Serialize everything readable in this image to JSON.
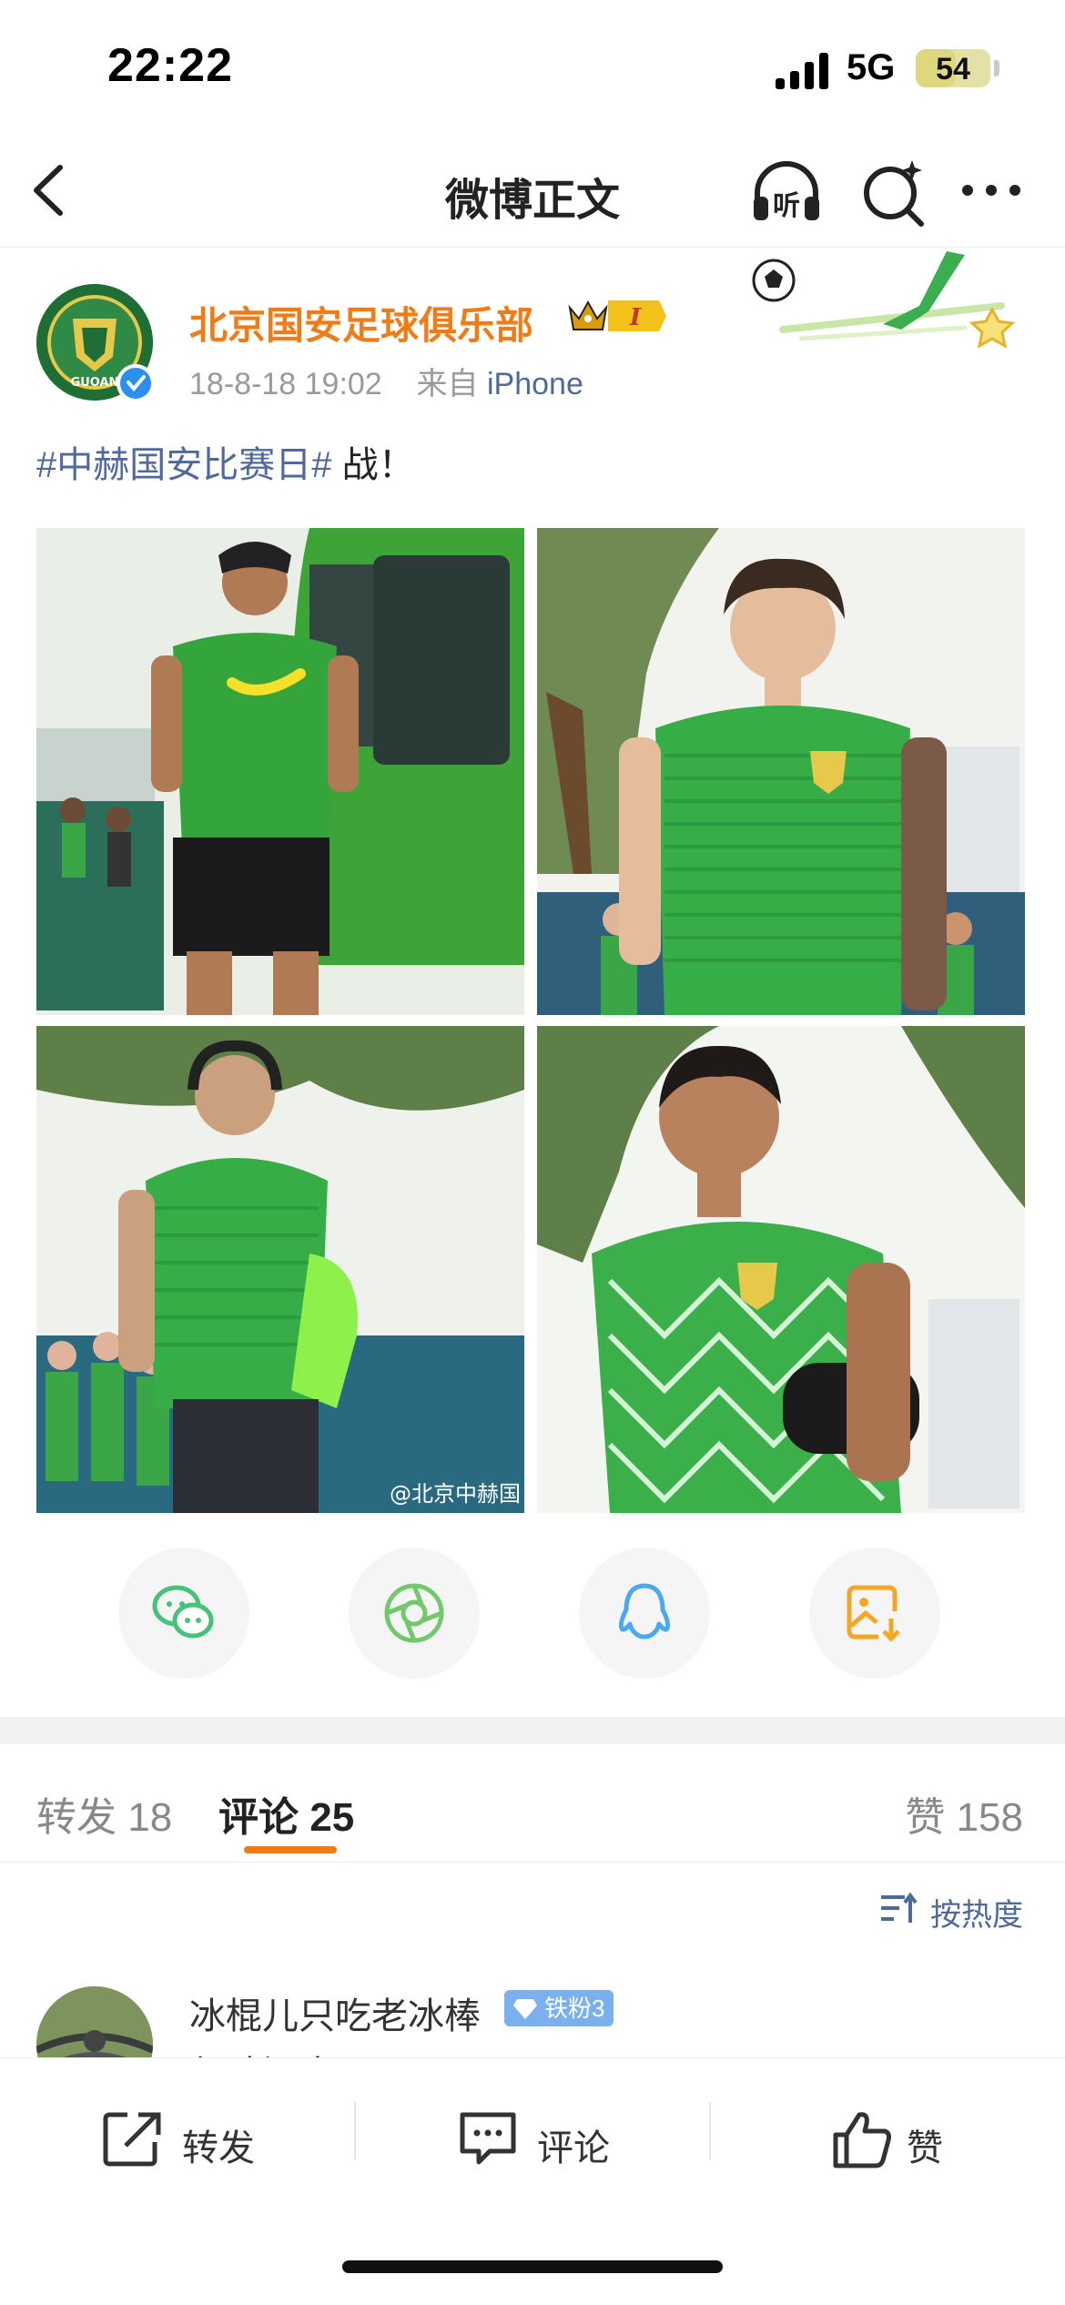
{
  "status_bar": {
    "time": "22:22",
    "network": "5G",
    "battery": "54",
    "battery_level": 0.54
  },
  "nav": {
    "title": "微博正文",
    "listen_label": "听"
  },
  "post": {
    "username": "北京国安足球俱乐部",
    "vip_level": "I",
    "date": "18-8-18 19:02",
    "source_prefix": "来自",
    "source": "iPhone",
    "hashtag": "#中赫国安比赛日#",
    "text": " 战！",
    "watermark": "@北京中赫国"
  },
  "share_icons": [
    "wechat-icon",
    "moments-icon",
    "qq-icon",
    "save-image-icon"
  ],
  "colors": {
    "accent": "#f07c17",
    "link": "#4f6a9a",
    "jersey_green": "#2faa4a"
  },
  "tabs": {
    "reposts_label": "转发",
    "reposts_count": "18",
    "comments_label": "评论",
    "comments_count": "25",
    "likes_label": "赞",
    "likes_count": "158"
  },
  "sort": {
    "label": "按热度"
  },
  "comment": {
    "username": "冰棍儿只吃老冰棒",
    "fan_badge": "铁粉3",
    "text": "保险温度震！"
  },
  "bottom_bar": {
    "repost_label": "转发",
    "comment_label": "评论",
    "like_label": "赞"
  }
}
